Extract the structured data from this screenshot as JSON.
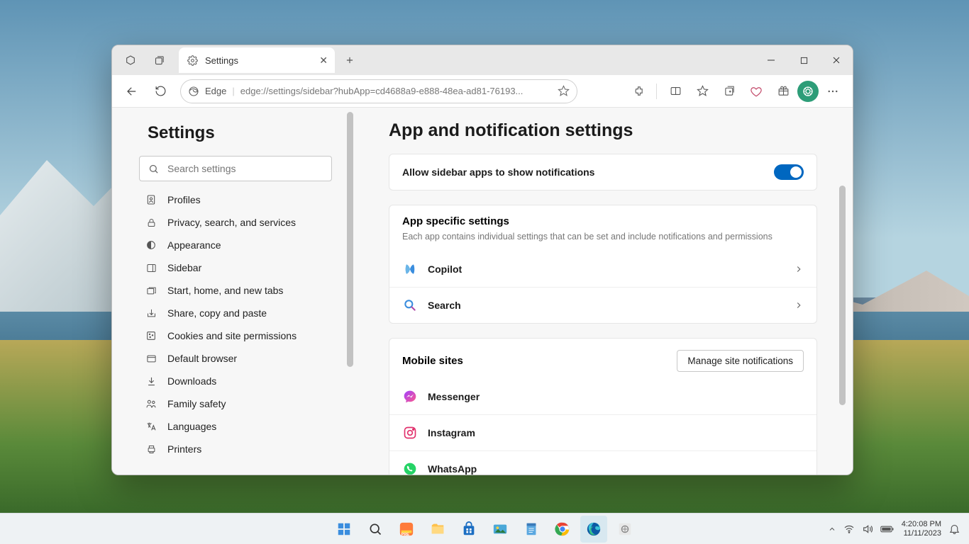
{
  "browser": {
    "tab_title": "Settings",
    "url_host": "Edge",
    "url_path": "edge://settings/sidebar?hubApp=cd4688a9-e888-48ea-ad81-76193..."
  },
  "sidebar": {
    "title": "Settings",
    "search_placeholder": "Search settings",
    "items": [
      {
        "label": "Profiles"
      },
      {
        "label": "Privacy, search, and services"
      },
      {
        "label": "Appearance"
      },
      {
        "label": "Sidebar"
      },
      {
        "label": "Start, home, and new tabs"
      },
      {
        "label": "Share, copy and paste"
      },
      {
        "label": "Cookies and site permissions"
      },
      {
        "label": "Default browser"
      },
      {
        "label": "Downloads"
      },
      {
        "label": "Family safety"
      },
      {
        "label": "Languages"
      },
      {
        "label": "Printers"
      }
    ]
  },
  "page": {
    "title": "App and notification settings",
    "allow_notifications_label": "Allow sidebar apps to show notifications",
    "allow_notifications_on": true,
    "section2_title": "App specific settings",
    "section2_subtitle": "Each app contains individual settings that can be set and include notifications and permissions",
    "apps": [
      {
        "label": "Copilot"
      },
      {
        "label": "Search"
      }
    ],
    "section3_title": "Mobile sites",
    "manage_button": "Manage site notifications",
    "sites": [
      {
        "label": "Messenger"
      },
      {
        "label": "Instagram"
      },
      {
        "label": "WhatsApp"
      }
    ]
  },
  "taskbar": {
    "time": "4:20:08 PM",
    "date": "11/11/2023"
  }
}
